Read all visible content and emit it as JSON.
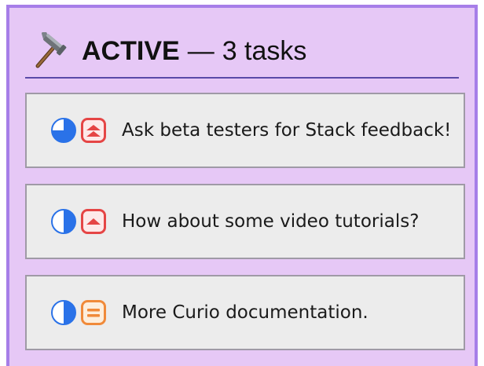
{
  "stack": {
    "status": "ACTIVE",
    "separator": "—",
    "count_text": "3 tasks",
    "icon": "hammer-icon",
    "colors": {
      "background": "#e6c8f6",
      "border": "#a67ee8",
      "progress": "#2a72e8",
      "priority_high": "#e54545",
      "priority_medium": "#f08a3a"
    }
  },
  "tasks": [
    {
      "label": "Ask beta testers for Stack feedback!",
      "progress_icon": "three-quarter-circle-icon",
      "progress": 0.75,
      "priority_icon": "double-chevron-up-icon",
      "priority": "highest"
    },
    {
      "label": "How about some video tutorials?",
      "progress_icon": "half-circle-icon",
      "progress": 0.5,
      "priority_icon": "chevron-up-icon",
      "priority": "high"
    },
    {
      "label": "More Curio documentation.",
      "progress_icon": "half-circle-icon",
      "progress": 0.5,
      "priority_icon": "equals-icon",
      "priority": "medium"
    }
  ]
}
